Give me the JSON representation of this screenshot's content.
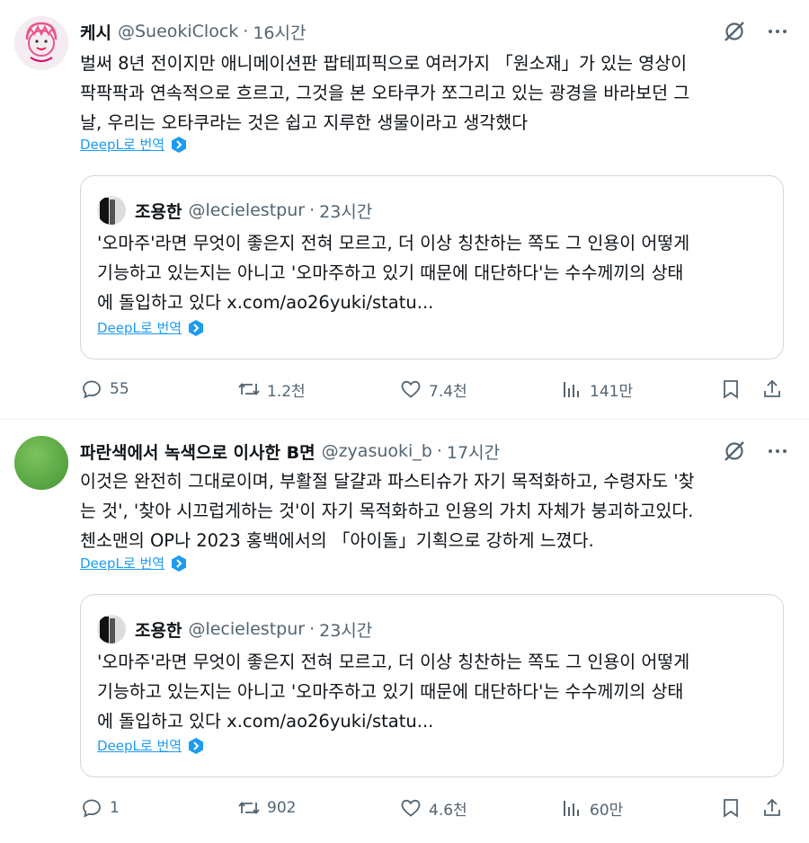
{
  "tweets": [
    {
      "display_name": "케시",
      "handle": "@SueokiClock",
      "separator": "·",
      "time": "16시간",
      "text": "벌써 8년 전이지만 애니메이션판 팝테피픽으로 여러가지 「원소재」가 있는 영상이\n팍팍팍과 연속적으로 흐르고, 그것을 본 오타쿠가 쪼그리고 있는 광경을 바라보던 그\n날, 우리는 오타쿠라는 것은 쉽고 지루한 생물이라고 생각했다",
      "translate_label": "DeepL로 번역",
      "quote": {
        "display_name": "조용한",
        "handle": "@lecielestpur",
        "separator": "·",
        "time": "23시간",
        "text": "'오마주'라면 무엇이 좋은지 전혀 모르고, 더 이상 칭찬하는 쪽도 그 인용이 어떻게\n기능하고 있는지는 아니고 '오마주하고 있기 때문에 대단하다'는 수수께끼의 상태\n에 돌입하고 있다 x.com/ao26yuki/statu...",
        "translate_label": "DeepL로 번역"
      },
      "metrics": {
        "replies": "55",
        "reposts": "1.2천",
        "likes": "7.4천",
        "views": "141만"
      },
      "avatar_color": "#f1e7ee"
    },
    {
      "display_name": "파란색에서 녹색으로 이사한 B면",
      "handle": "@zyasuoki_b",
      "separator": "·",
      "time": "17시간",
      "text": "이것은 완전히 그대로이며, 부활절 달걀과 파스티슈가 자기 목적화하고, 수령자도 '찾\n는 것', '찾아 시끄럽게하는 것'이 자기 목적화하고 인용의 가치 자체가 붕괴하고있다.\n첸소맨의 OP나 2023 홍백에서의 「아이돌」기획으로 강하게 느꼈다.",
      "translate_label": "DeepL로 번역",
      "quote": {
        "display_name": "조용한",
        "handle": "@lecielestpur",
        "separator": "·",
        "time": "23시간",
        "text": "'오마주'라면 무엇이 좋은지 전혀 모르고, 더 이상 칭찬하는 쪽도 그 인용이 어떻게\n기능하고 있는지는 아니고 '오마주하고 있기 때문에 대단하다'는 수수께끼의 상태\n에 돌입하고 있다 x.com/ao26yuki/statu...",
        "translate_label": "DeepL로 번역"
      },
      "metrics": {
        "replies": "1",
        "reposts": "902",
        "likes": "4.6천",
        "views": "60만"
      },
      "avatar_color": "#5aae45"
    }
  ],
  "icons": {
    "grok": "grok-icon",
    "more": "more-icon",
    "reply": "reply-icon",
    "repost": "repost-icon",
    "like": "heart-icon",
    "views": "views-chart-icon",
    "bookmark": "bookmark-icon",
    "share": "share-icon",
    "deepl": "deepl-icon"
  },
  "colors": {
    "link": "#1d9bf0",
    "secondary_text": "#536471",
    "border": "#cfd9de"
  }
}
